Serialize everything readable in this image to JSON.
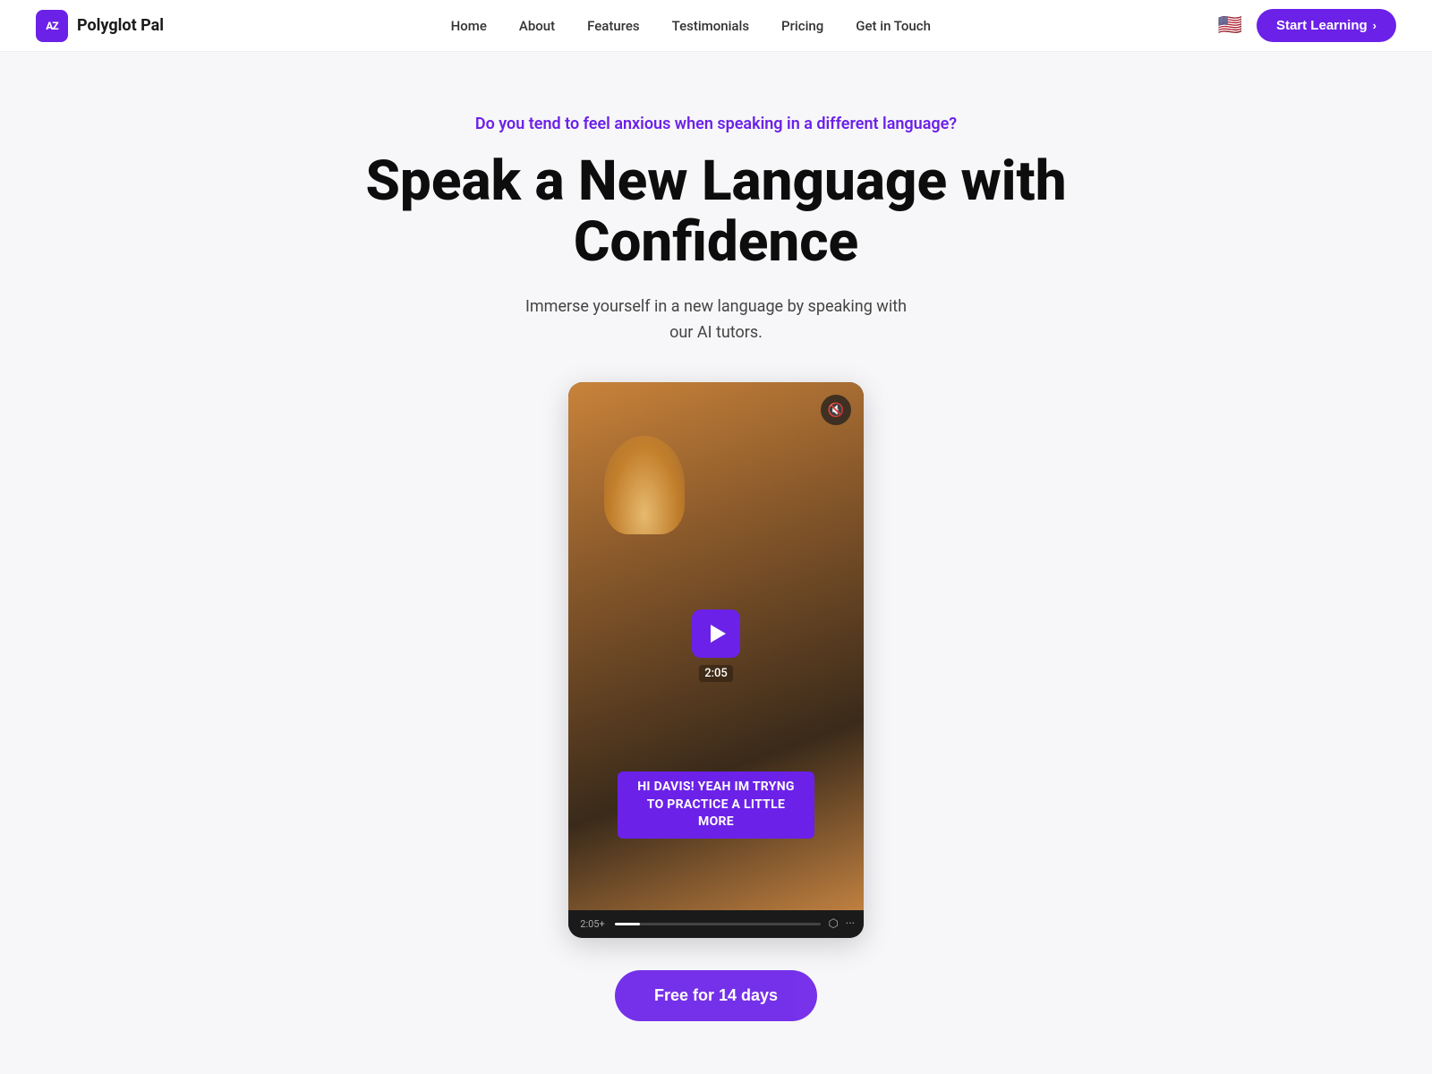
{
  "brand": {
    "logo_text": "AZ",
    "name": "Polyglot Pal"
  },
  "nav": {
    "links": [
      {
        "id": "home",
        "label": "Home"
      },
      {
        "id": "about",
        "label": "About"
      },
      {
        "id": "features",
        "label": "Features"
      },
      {
        "id": "testimonials",
        "label": "Testimonials"
      },
      {
        "id": "pricing",
        "label": "Pricing"
      },
      {
        "id": "get-in-touch",
        "label": "Get in Touch"
      }
    ],
    "flag": "🇺🇸",
    "cta_label": "Start Learning",
    "cta_chevron": "›"
  },
  "hero": {
    "tagline": "Do you tend to feel anxious when speaking in a different language?",
    "title": "Speak a New Language with Confidence",
    "subtitle": "Immerse yourself in a new language by speaking with\nour AI tutors."
  },
  "video": {
    "duration": "2:05",
    "current_time": "2:05+",
    "subtitle_text": "HI DAVIS! YEAH IM TRYNG TO\nPRACTICE A LITTLE MORE",
    "mute_icon": "🔇"
  },
  "cta_bottom": {
    "label": "Free for 14 days"
  },
  "colors": {
    "purple": "#6b21e8",
    "dark": "#0d0d0d",
    "gray": "#444444"
  }
}
